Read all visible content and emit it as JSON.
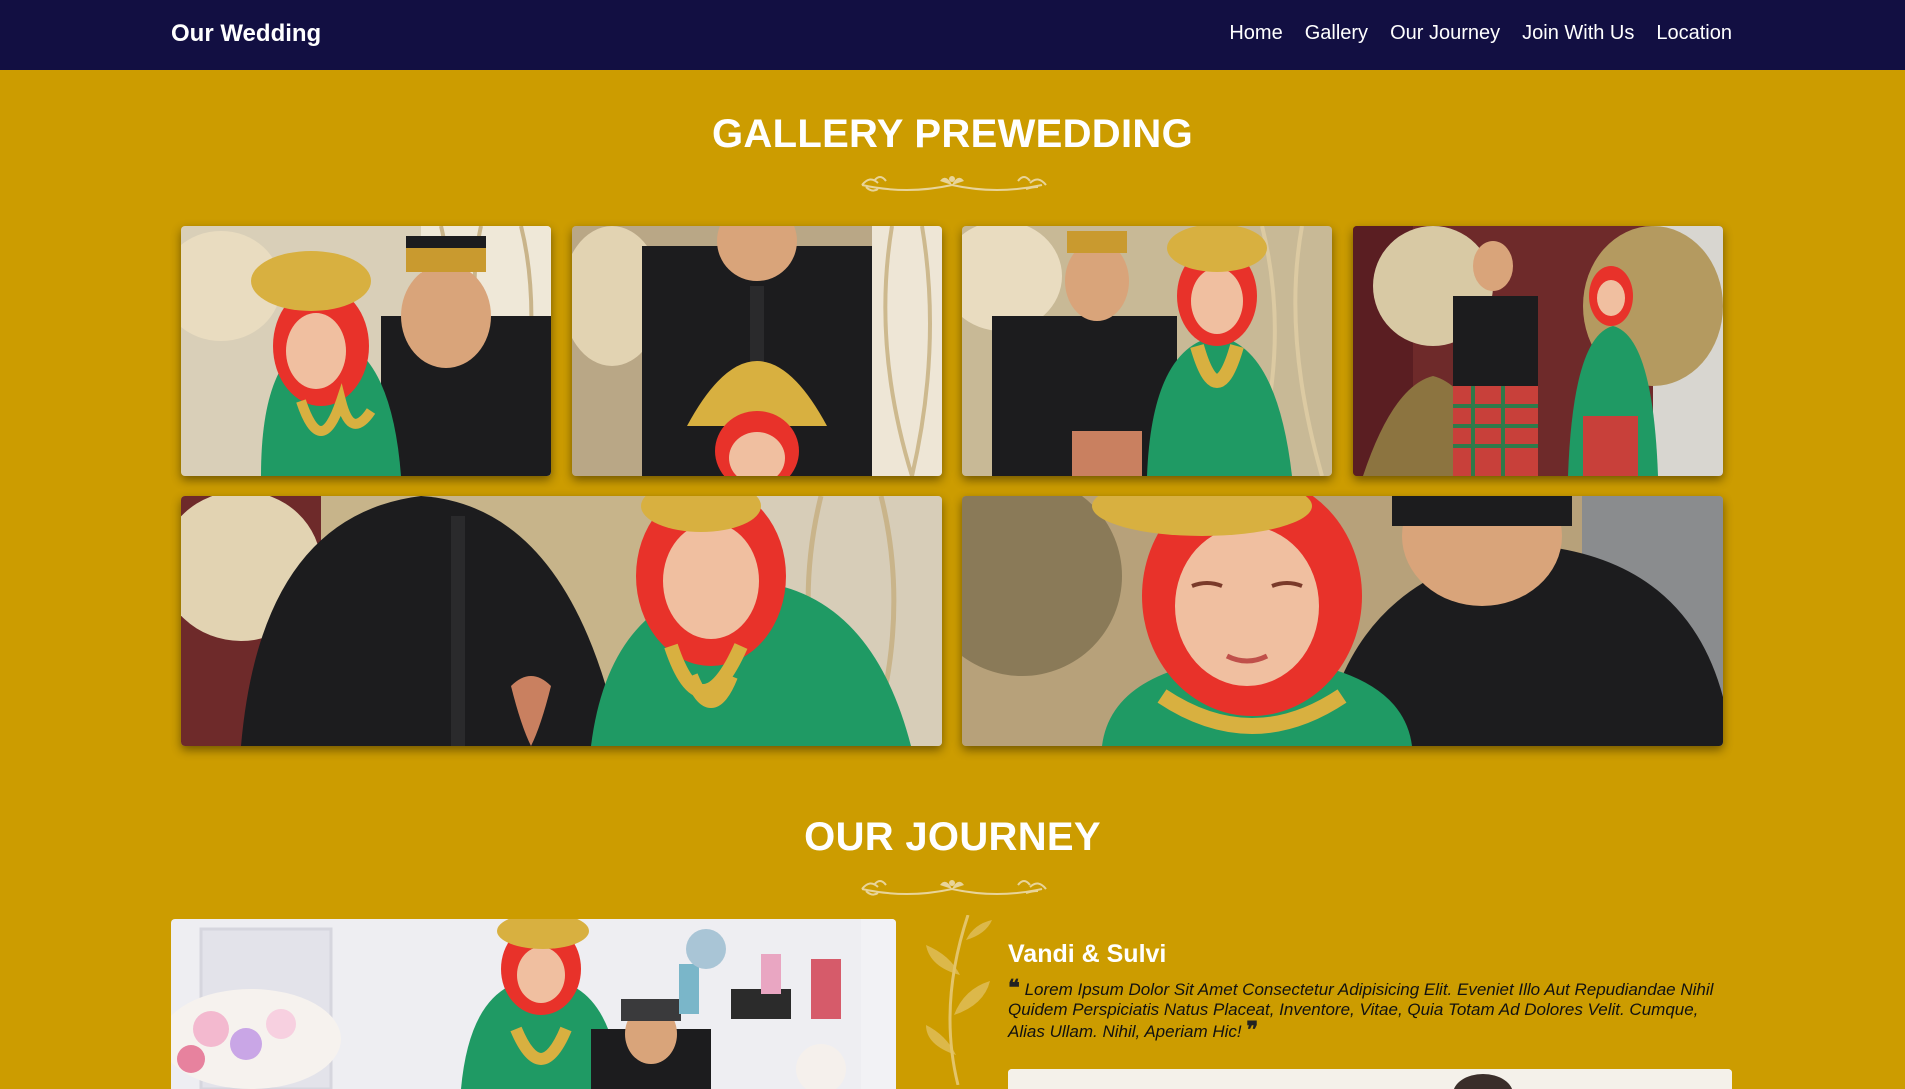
{
  "navbar": {
    "brand": "Our Wedding",
    "links": [
      "Home",
      "Gallery",
      "Our Journey",
      "Join With Us",
      "Location"
    ]
  },
  "gallery": {
    "title": "GALLERY PREWEDDING",
    "photos": [
      "couple-photo-1",
      "couple-photo-2",
      "couple-photo-3",
      "couple-photo-4",
      "couple-photo-5",
      "couple-photo-6"
    ]
  },
  "journey": {
    "title": "OUR JOURNEY",
    "couple_name": "Vandi & Sulvi",
    "quote": "Lorem Ipsum Dolor Sit Amet Consectetur Adipisicing Elit. Eveniet Illo Aut Repudiandae Nihil Quidem Perspiciatis Natus Placeat, Inventore, Vitae, Quia Totam Ad Dolores Velit. Cumque, Alias Ullam. Nihil, Aperiam Hic!"
  },
  "colors": {
    "navbar": "#120f42",
    "background": "#cc9c00",
    "heading": "#ffffff",
    "bride_dress": "#1f9a64",
    "hijab": "#e8322a",
    "groom_suit": "#1c1c1e",
    "gold": "#d8b040"
  },
  "icons": {
    "open_quote": "quote-open-icon",
    "close_quote": "quote-close-icon",
    "divider": "floral-divider-icon"
  }
}
